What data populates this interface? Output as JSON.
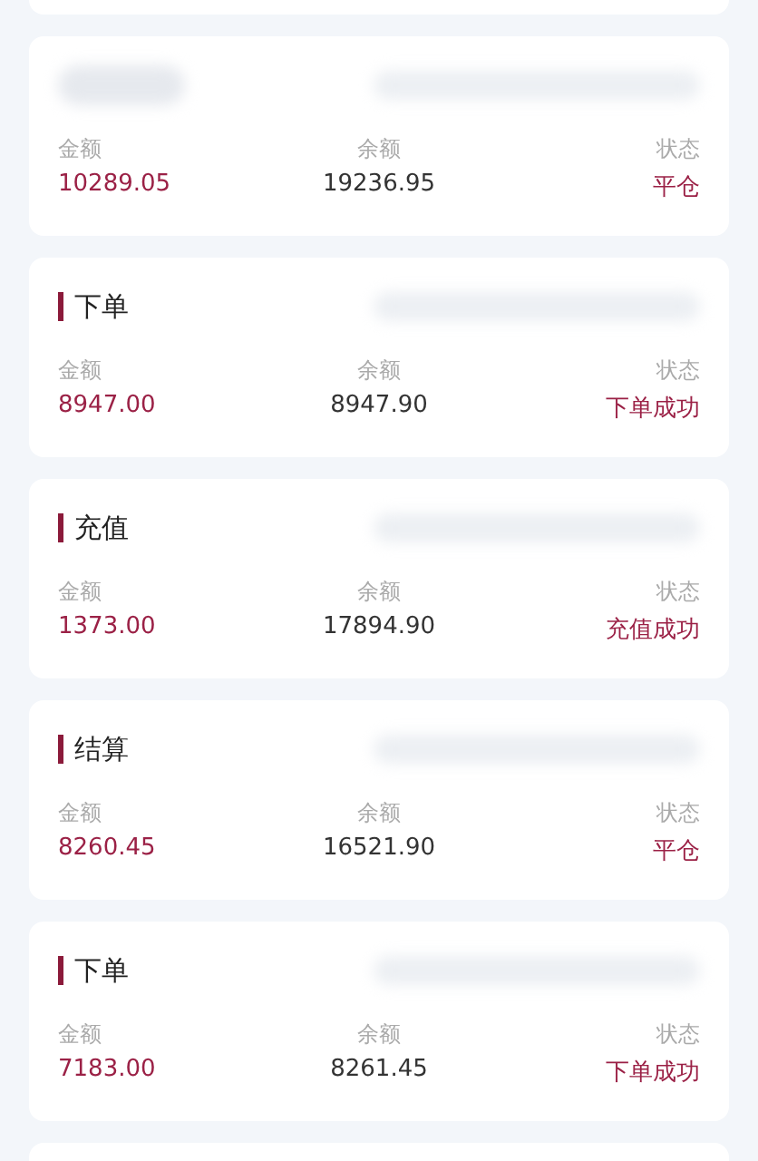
{
  "records": [
    {
      "title_blurred": true,
      "amount_label": "金额",
      "amount": "10289.05",
      "balance_label": "余额",
      "balance": "19236.95",
      "status_label": "状态",
      "status": "平仓"
    },
    {
      "title": "下单",
      "amount_label": "金额",
      "amount": "8947.00",
      "balance_label": "余额",
      "balance": "8947.90",
      "status_label": "状态",
      "status": "下单成功"
    },
    {
      "title": "充值",
      "amount_label": "金额",
      "amount": "1373.00",
      "balance_label": "余额",
      "balance": "17894.90",
      "status_label": "状态",
      "status": "充值成功"
    },
    {
      "title": "结算",
      "amount_label": "金额",
      "amount": "8260.45",
      "balance_label": "余额",
      "balance": "16521.90",
      "status_label": "状态",
      "status": "平仓"
    },
    {
      "title": "下单",
      "amount_label": "金额",
      "amount": "7183.00",
      "balance_label": "余额",
      "balance": "8261.45",
      "status_label": "状态",
      "status": "下单成功"
    }
  ]
}
